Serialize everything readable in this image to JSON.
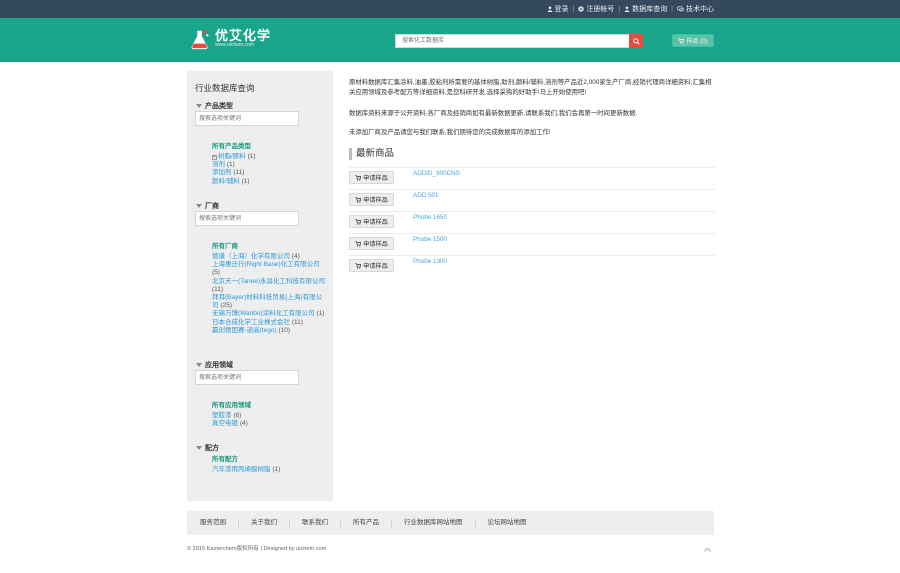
{
  "topbar": {
    "login": "登录",
    "register": "注册帐号",
    "database": "数据库查询",
    "tech": "技术中心"
  },
  "header": {
    "logo_title": "优艾化学",
    "logo_sub": "www.uichem.com",
    "search_placeholder": "搜索化工数据库",
    "cart_label": "样品 (0)"
  },
  "sidebar": {
    "title": "行业数据库查询",
    "filter_placeholder": "搜索选项关键词",
    "sections": {
      "product": {
        "label": "产品类型",
        "all": "所有产品类型",
        "items": [
          {
            "name": "树脂/原料",
            "count": "(1)"
          },
          {
            "name": "溶剂",
            "count": "(1)"
          },
          {
            "name": "添加剂",
            "count": "(11)"
          },
          {
            "name": "颜料/辅料",
            "count": "(1)"
          }
        ]
      },
      "vendor": {
        "label": "厂商",
        "all": "所有厂商",
        "items": [
          {
            "name": "德谦（上海）化学有限公司",
            "count": "(4)"
          },
          {
            "name": "上海惠迁行(Right Base)化工有限公司",
            "count": "(5)"
          },
          {
            "name": "北京天一(Tanee)永昌化工科技有限公司",
            "count": "(11)"
          },
          {
            "name": "拜耳(Bayer)材料科技贸易(上海)有限公司",
            "count": "(25)"
          },
          {
            "name": "无锡万博(Wanbo)涂料化工有限公司",
            "count": "(1)"
          },
          {
            "name": "日本合成化学工业株式会社",
            "count": "(11)"
          },
          {
            "name": "赢创德固赛-迪高(tego)",
            "count": "(10)"
          }
        ]
      },
      "application": {
        "label": "应用领域",
        "all": "所有应用领域",
        "items": [
          {
            "name": "塑胶漆",
            "count": "(6)"
          },
          {
            "name": "真空电镀",
            "count": "(4)"
          }
        ]
      },
      "formula": {
        "label": "配方",
        "all": "所有配方",
        "items": [
          {
            "name": "汽车漆用丙烯酸树脂",
            "count": "(1)"
          }
        ]
      }
    }
  },
  "main": {
    "intro1": "原材料数据库汇集涂料,油墨,胶粘剂所需要的基体树脂,助剂,颜料/辅料,溶剂等产品近2,000家生产厂商,经销代理商详细资料;汇集相关应用领域及参考配方等详细资料,是您科研开发,选择采购的好助手!马上开始使用吧!",
    "intro2": "数据库资料来源于公开资料,各厂商及经销商如有最新数据更新,请联系我们,我们会再第一时间更新数据.",
    "intro3": "未添加厂商及产品请您与我们联系,我们期待您的完成数据库的添加工作!",
    "latest_title": "最新商品",
    "request_label": "申请样品",
    "products": [
      "ADDID_900CNS",
      "ADD 501",
      "Phobe 1650",
      "Phobe 1500",
      "Phobe 1300"
    ]
  },
  "footer": {
    "links": [
      "服务范围",
      "关于我们",
      "联系我们",
      "所有产品",
      "行业数据库网站地图",
      "论坛网站地图"
    ],
    "copyright": "© 2015 Kaxterchem版权所有 | Designed by uichem.com"
  },
  "colors": {
    "topbar": "#34495e",
    "header": "#19a589",
    "search_button": "#e64c3c",
    "link": "#2a9ad8",
    "group_heading": "#1a9a7e"
  }
}
